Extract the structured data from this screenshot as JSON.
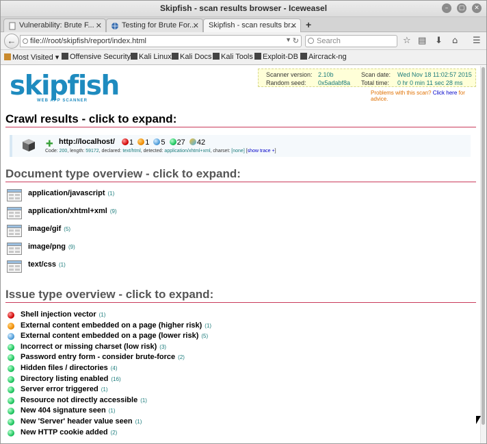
{
  "window": {
    "title": "Skipfish - scan results browser - Iceweasel"
  },
  "tabs": [
    {
      "label": "Vulnerability: Brute F...",
      "active": false
    },
    {
      "label": "Testing for Brute For...",
      "active": false
    },
    {
      "label": "Skipfish - scan results br...",
      "active": true
    }
  ],
  "nav": {
    "url": "file:///root/skipfish/report/index.html",
    "search_placeholder": "Search"
  },
  "bookmarks": [
    "Most Visited ▾",
    "Offensive Security",
    "Kali Linux",
    "Kali Docs",
    "Kali Tools",
    "Exploit-DB",
    "Aircrack-ng"
  ],
  "info": {
    "scanner_version_label": "Scanner version:",
    "scanner_version": "2.10b",
    "scan_date_label": "Scan date:",
    "scan_date": "Wed Nov 18 11:02:57 2015",
    "random_seed_label": "Random seed:",
    "random_seed": "0x5adabf8a",
    "total_time_label": "Total time:",
    "total_time": "0 hr 0 min 11 sec 28 ms",
    "problems_pre": "Problems with this scan?",
    "problems_link": "Click here",
    "problems_post": "for advice."
  },
  "logo": {
    "word": "skipfish",
    "sub": "WEB APP SCANNER"
  },
  "crawl": {
    "heading": "Crawl results - click to expand:",
    "url": "http://localhost/",
    "counts": {
      "high": "1",
      "medium": "1",
      "low": "5",
      "info": "27",
      "notes": "42"
    },
    "meta": {
      "code_label": "Code:",
      "code": "200",
      "length_label": ", length:",
      "length": "59172",
      "declared_label": ", declared:",
      "declared": "text/html",
      "detected_label": ", detected:",
      "detected": "application/xhtml+xml",
      "charset_label": ", charset:",
      "charset": "[none]",
      "trace_pre": "[",
      "trace_link": "show trace +",
      "trace_post": "]"
    }
  },
  "doctypes": {
    "heading": "Document type overview - click to expand:",
    "items": [
      {
        "label": "application/javascript",
        "count": "(1)"
      },
      {
        "label": "application/xhtml+xml",
        "count": "(9)"
      },
      {
        "label": "image/gif",
        "count": "(5)"
      },
      {
        "label": "image/png",
        "count": "(9)"
      },
      {
        "label": "text/css",
        "count": "(1)"
      }
    ]
  },
  "issues": {
    "heading": "Issue type overview - click to expand:",
    "items": [
      {
        "label": "Shell injection vector",
        "count": "(1)",
        "severity": "red"
      },
      {
        "label": "External content embedded on a page (higher risk)",
        "count": "(1)",
        "severity": "orange"
      },
      {
        "label": "External content embedded on a page (lower risk)",
        "count": "(5)",
        "severity": "blue"
      },
      {
        "label": "Incorrect or missing charset (low risk)",
        "count": "(3)",
        "severity": "green"
      },
      {
        "label": "Password entry form - consider brute-force",
        "count": "(2)",
        "severity": "green"
      },
      {
        "label": "Hidden files / directories",
        "count": "(4)",
        "severity": "green"
      },
      {
        "label": "Directory listing enabled",
        "count": "(16)",
        "severity": "green"
      },
      {
        "label": "Server error triggered",
        "count": "(1)",
        "severity": "green"
      },
      {
        "label": "Resource not directly accessible",
        "count": "(1)",
        "severity": "green"
      },
      {
        "label": "New 404 signature seen",
        "count": "(1)",
        "severity": "green"
      },
      {
        "label": "New 'Server' header value seen",
        "count": "(1)",
        "severity": "green"
      },
      {
        "label": "New HTTP cookie added",
        "count": "(2)",
        "severity": "green"
      }
    ]
  },
  "colors": {
    "accent": "#1e8bbf",
    "heading_rule": "#c93a5a",
    "info_bg": "#ffffd8",
    "value": "#1a7b7b"
  }
}
